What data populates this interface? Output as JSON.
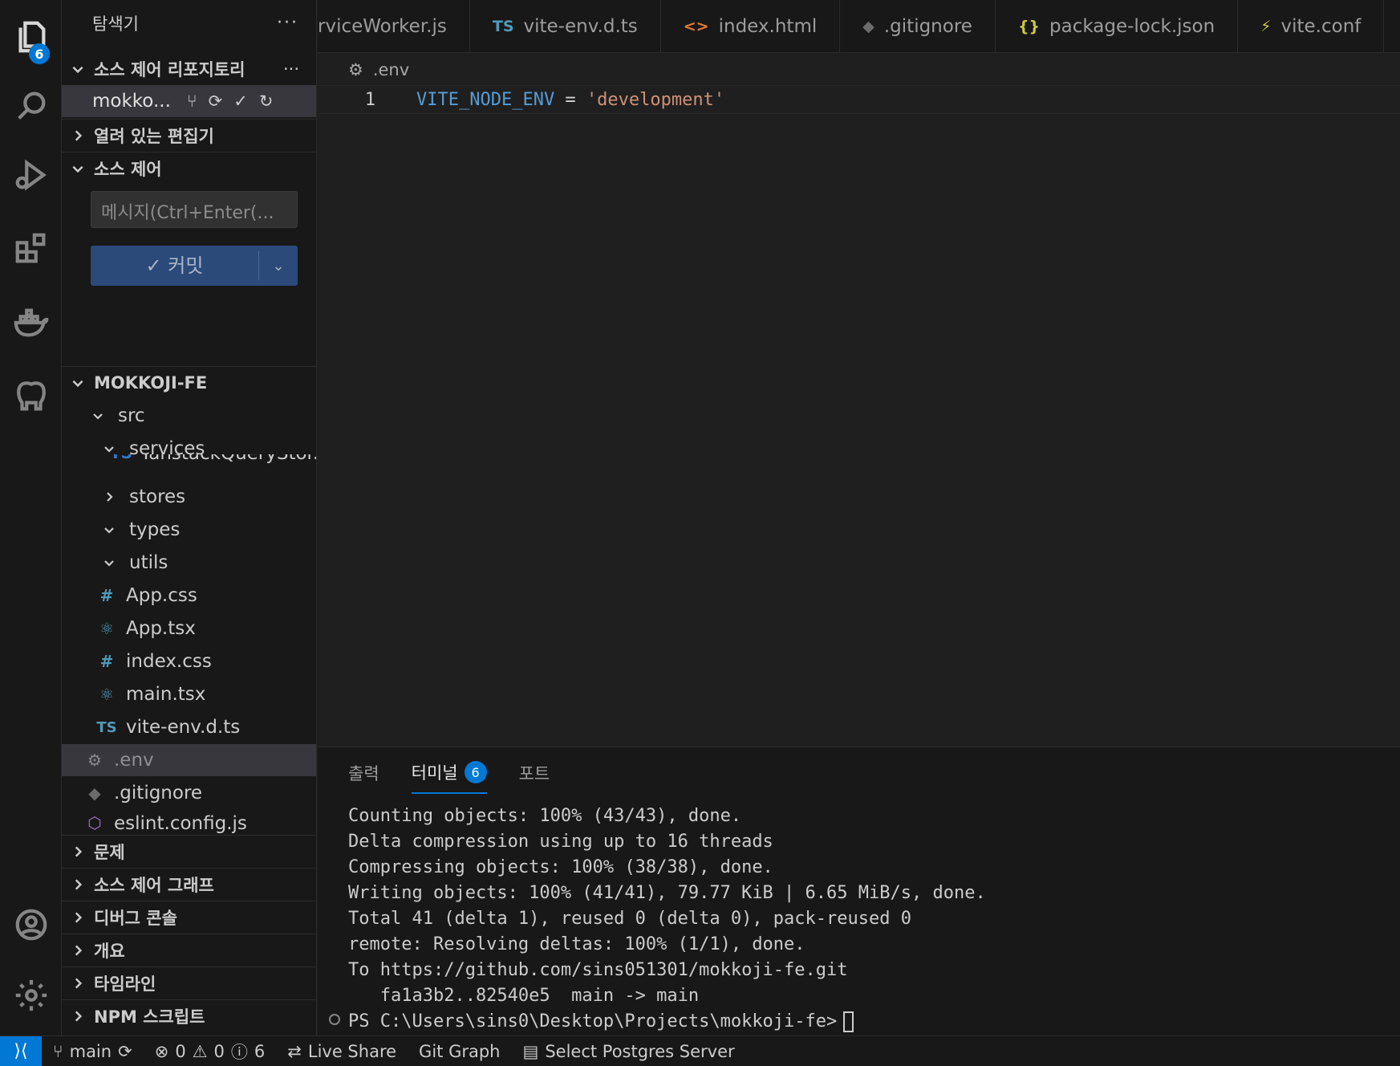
{
  "activity_bar": {
    "explorer_badge": "6",
    "items": [
      "explorer-icon",
      "search-icon",
      "run-debug-icon",
      "extensions-icon",
      "docker-icon",
      "postgres-icon"
    ],
    "bottom": [
      "account-icon",
      "gear-icon"
    ]
  },
  "sidebar": {
    "title": "탐색기",
    "more": "···",
    "repos_section": "소스 제어 리포지토리",
    "repo_name": "mokko...",
    "open_editors": "열려 있는 편집기",
    "scm_section": "소스 제어",
    "message_placeholder": "메시지(Ctrl+Enter(...",
    "commit_label": "✓ 커밋",
    "project": "MOKKOJI-FE",
    "tree": [
      {
        "label": "src",
        "kind": "folder-open"
      },
      {
        "label": "services",
        "kind": "folder-open"
      },
      {
        "label": "TanstackQueryStor...",
        "kind": "ts"
      },
      {
        "label": "stores",
        "kind": "folder-closed"
      },
      {
        "label": "types",
        "kind": "folder-open"
      },
      {
        "label": "utils",
        "kind": "folder-open"
      },
      {
        "label": "App.css",
        "kind": "css"
      },
      {
        "label": "App.tsx",
        "kind": "react"
      },
      {
        "label": "index.css",
        "kind": "css"
      },
      {
        "label": "main.tsx",
        "kind": "react"
      },
      {
        "label": "vite-env.d.ts",
        "kind": "ts"
      },
      {
        "label": ".env",
        "kind": "gear"
      },
      {
        "label": ".gitignore",
        "kind": "git"
      },
      {
        "label": "eslint.config.js",
        "kind": "eslint"
      }
    ],
    "bottom_sections": [
      "문제",
      "소스 제어 그래프",
      "디버그 콘솔",
      "개요",
      "타임라인",
      "NPM 스크립트"
    ]
  },
  "tabs": [
    {
      "icon": "",
      "label": "rviceWorker.js"
    },
    {
      "icon": "TS",
      "label": "vite-env.d.ts"
    },
    {
      "icon": "<>",
      "label": "index.html"
    },
    {
      "icon": "◆",
      "label": ".gitignore"
    },
    {
      "icon": "{}",
      "label": "package-lock.json"
    },
    {
      "icon": "⚡",
      "label": "vite.conf"
    }
  ],
  "editor": {
    "breadcrumb": ".env",
    "line_number": "1",
    "code_var": "VITE_NODE_ENV",
    "code_op": " = ",
    "code_str": "'development'"
  },
  "panel": {
    "tabs": [
      "출력",
      "터미널",
      "포트"
    ],
    "terminal_badge": "6",
    "lines": [
      "Counting objects: 100% (43/43), done.",
      "Delta compression using up to 16 threads",
      "Compressing objects: 100% (38/38), done.",
      "Writing objects: 100% (41/41), 79.77 KiB | 6.65 MiB/s, done.",
      "Total 41 (delta 1), reused 0 (delta 0), pack-reused 0",
      "remote: Resolving deltas: 100% (1/1), done.",
      "To https://github.com/sins051301/mokkoji-fe.git",
      "   fa1a3b2..82540e5  main -> main",
      "PS C:\\Users\\sins0\\Desktop\\Projects\\mokkoji-fe>"
    ]
  },
  "status": {
    "branch": "main",
    "errors": "0",
    "warnings": "0",
    "infos": "6",
    "live_share": "Live Share",
    "git_graph": "Git Graph",
    "postgres": "Select Postgres Server"
  },
  "colors": {
    "accent": "#0078d4",
    "bg": "#1f1f1f",
    "sidebar": "#181818"
  }
}
